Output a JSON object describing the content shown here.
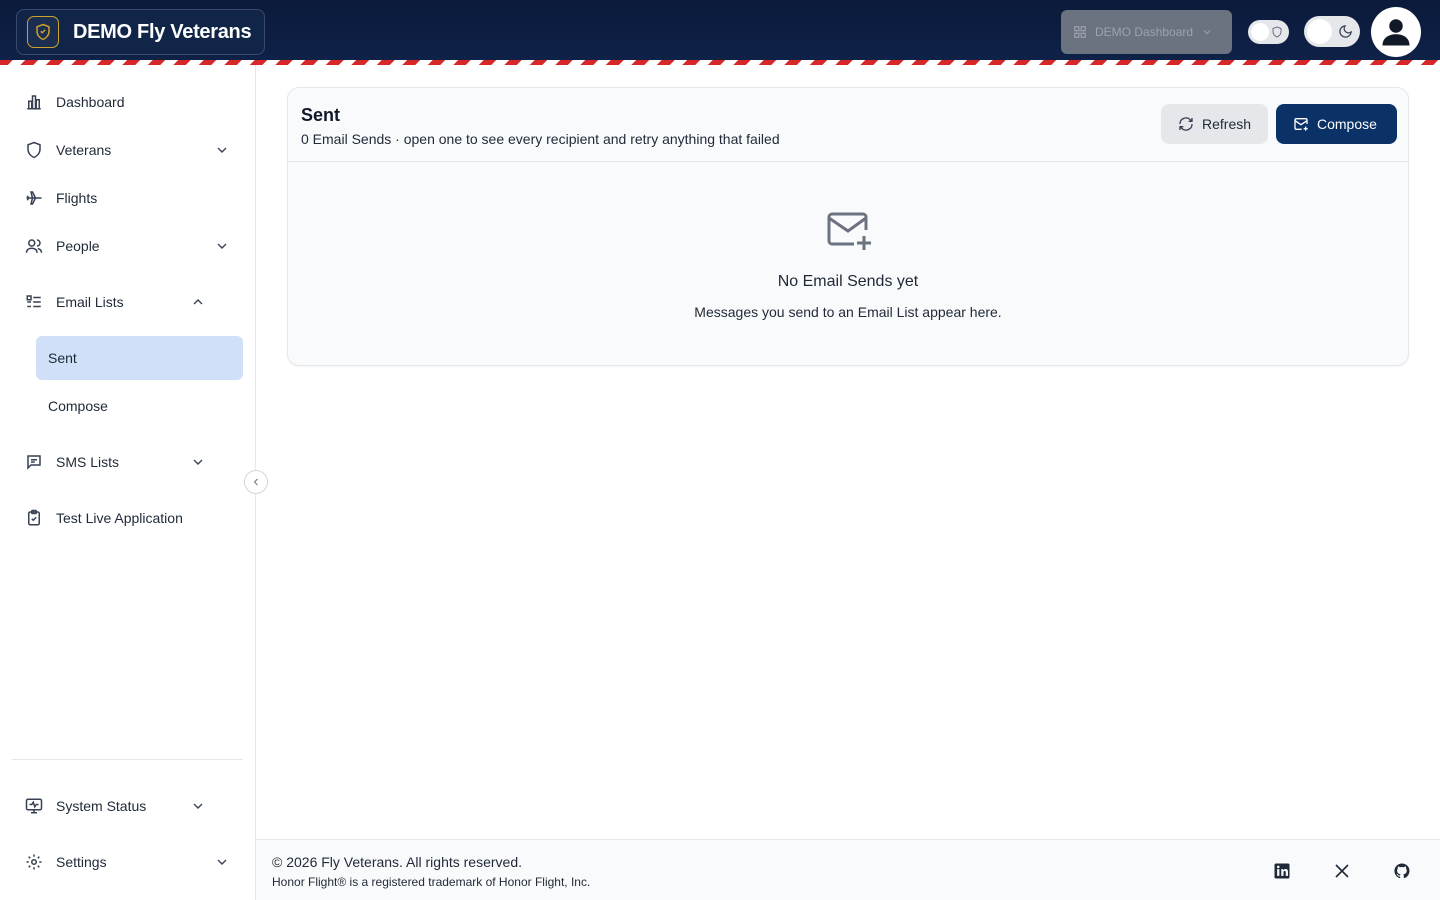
{
  "header": {
    "app_title": "DEMO Fly Veterans",
    "dashboard_select": "DEMO Dashboard",
    "icons": {
      "brand": "shield-icon",
      "select": "grid-icon",
      "theme": "moon-icon",
      "avatar": "user-icon"
    }
  },
  "sidebar": {
    "items": [
      {
        "label": "Dashboard",
        "icon": "bar-chart-icon"
      },
      {
        "label": "Veterans",
        "icon": "shield-icon"
      },
      {
        "label": "Flights",
        "icon": "plane-icon"
      },
      {
        "label": "People",
        "icon": "users-icon"
      },
      {
        "label": "Email Lists",
        "icon": "list-icon"
      },
      {
        "label": "SMS Lists",
        "icon": "message-icon"
      },
      {
        "label": "Test Live Application",
        "icon": "clipboard-check-icon"
      }
    ],
    "email_sub": [
      "Sent",
      "Compose"
    ],
    "bottom": [
      {
        "label": "System Status",
        "icon": "monitor-icon"
      },
      {
        "label": "Settings",
        "icon": "gear-icon"
      }
    ]
  },
  "main": {
    "title": "Sent",
    "subtitle": "0 Email Sends · open one to see every recipient and retry anything that failed",
    "refresh_label": "Refresh",
    "compose_label": "Compose",
    "empty_title": "No Email Sends yet",
    "empty_sub": "Messages you send to an Email List appear here."
  },
  "footer": {
    "copyright": "© 2026 Fly Veterans. All rights reserved.",
    "trademark": "Honor Flight® is a registered trademark of Honor Flight, Inc.",
    "social": [
      "linkedin-icon",
      "x-icon",
      "github-icon"
    ]
  },
  "colors": {
    "header_bg": "#0b1a3a",
    "accent": "#0b3266",
    "active_bg": "#cfe0f8",
    "stripe_red": "#d62828"
  }
}
